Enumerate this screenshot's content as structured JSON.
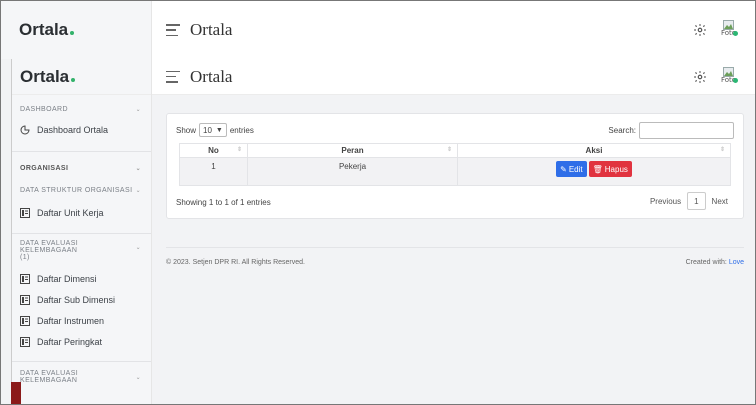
{
  "brand": {
    "name": "Ortala"
  },
  "header": {
    "title": "Ortala",
    "avatar_alt": "Foto"
  },
  "inner_brand": {
    "name": "Ortala"
  },
  "inner_header": {
    "title": "Ortala",
    "avatar_alt": "Foto"
  },
  "sidebar": {
    "dashboard_heading": "DASHBOARD",
    "dashboard_item": "Dashboard Ortala",
    "organisasi_heading": "ORGANISASI",
    "struktur_heading": "DATA STRUKTUR ORGANISASI",
    "unit_kerja": "Daftar Unit Kerja",
    "evaluasi_heading_1": "DATA EVALUASI KELEMBAGAAN",
    "evaluasi_heading_1_sub": "(1)",
    "items": [
      "Daftar Dimensi",
      "Daftar Sub Dimensi",
      "Daftar Instrumen",
      "Daftar Peringkat"
    ],
    "evaluasi_heading_2": "DATA EVALUASI KELEMBAGAAN"
  },
  "datatable": {
    "show_label": "Show",
    "entries_value": "10",
    "entries_label": "entries",
    "search_label": "Search:",
    "columns": [
      "No",
      "Peran",
      "Aksi"
    ],
    "rows": [
      {
        "no": "1",
        "peran": "Pekerja"
      }
    ],
    "edit_label": "Edit",
    "delete_label": "Hapus",
    "info": "Showing 1 to 1 of 1 entries",
    "prev_label": "Previous",
    "current_page": "1",
    "next_label": "Next"
  },
  "footer": {
    "copyright": "© 2023. Setjen DPR RI. All Rights Reserved.",
    "created_prefix": "Created with: ",
    "created_link": "Love"
  },
  "colors": {
    "accent": "#2f6ee8",
    "danger": "#e1333f",
    "online": "#2bb673"
  }
}
